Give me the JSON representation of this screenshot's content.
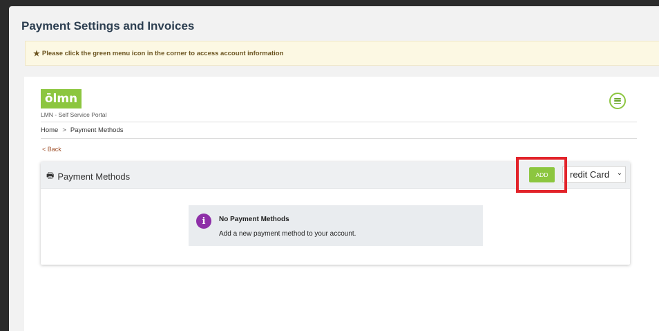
{
  "page": {
    "title": "Payment Settings and Invoices"
  },
  "notice": {
    "text": "Please click the green menu icon in the corner to access account information"
  },
  "portal": {
    "logo_text": "ōlmn",
    "name": "LMN - Self Service Portal",
    "breadcrumb": [
      "Home",
      ">",
      "Payment Methods"
    ],
    "back_label": "< Back"
  },
  "panel": {
    "title": "Payment Methods",
    "add_label": "ADD",
    "select_value": "redit Card",
    "empty_title": "No Payment Methods",
    "empty_message": "Add a new payment method to your account."
  },
  "colors": {
    "brand_green": "#8cc63f",
    "highlight_red": "#e2232a",
    "info_purple": "#8e2fa8"
  }
}
